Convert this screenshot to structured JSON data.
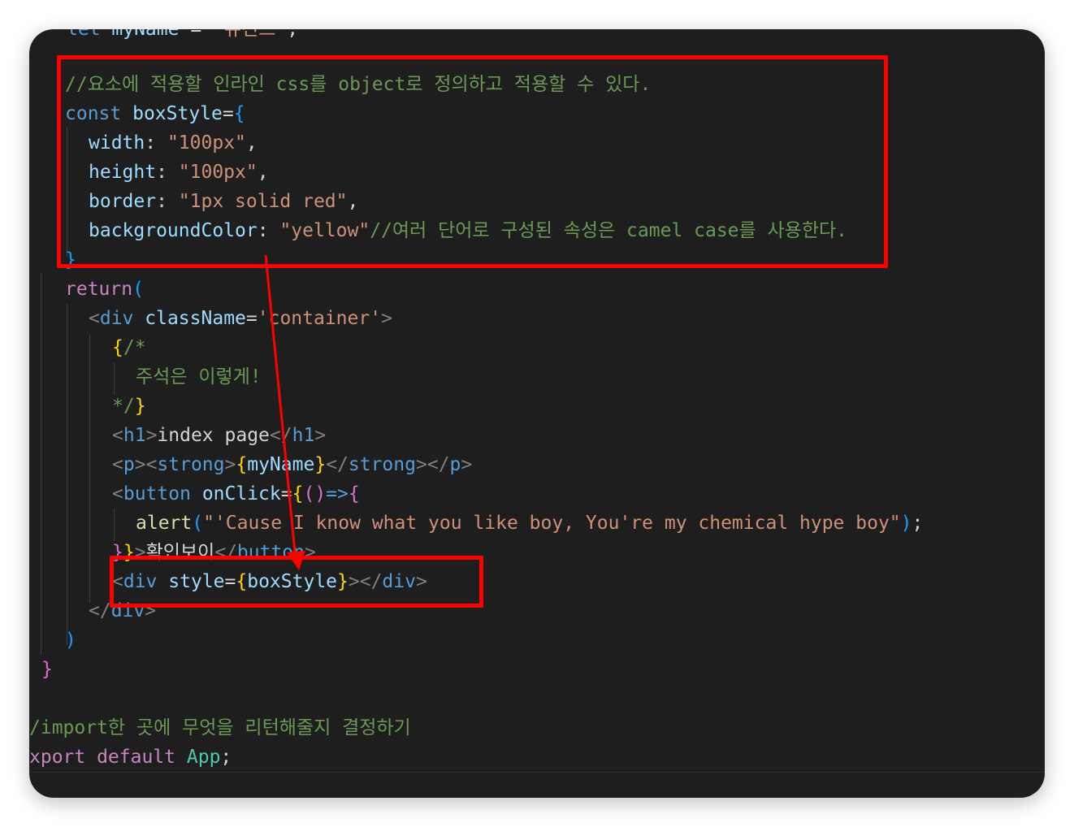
{
  "editor": {
    "lines": [
      {
        "id": "l-top",
        "segs": [
          [
            "kw",
            "let "
          ],
          [
            "var",
            "myName"
          ],
          [
            "pl",
            " = "
          ],
          [
            "str",
            "\"뉴진스\""
          ],
          [
            "pl",
            ";"
          ]
        ]
      },
      {
        "id": "l-comment1",
        "segs": [
          [
            "cm",
            "//요소에 적용할 인라인 css를 object로 정의하고 적용할 수 있다."
          ]
        ]
      },
      {
        "id": "l-const",
        "segs": [
          [
            "kw",
            "const "
          ],
          [
            "var",
            "boxStyle"
          ],
          [
            "pl",
            "="
          ],
          [
            "p3",
            "{"
          ]
        ]
      },
      {
        "id": "l-width",
        "segs": [
          [
            "prop",
            "width"
          ],
          [
            "pl",
            ": "
          ],
          [
            "str",
            "\"100px\""
          ],
          [
            "pl",
            ","
          ]
        ]
      },
      {
        "id": "l-height",
        "segs": [
          [
            "prop",
            "height"
          ],
          [
            "pl",
            ": "
          ],
          [
            "str",
            "\"100px\""
          ],
          [
            "pl",
            ","
          ]
        ]
      },
      {
        "id": "l-border",
        "segs": [
          [
            "prop",
            "border"
          ],
          [
            "pl",
            ": "
          ],
          [
            "str",
            "\"1px solid red\""
          ],
          [
            "pl",
            ","
          ]
        ]
      },
      {
        "id": "l-bg",
        "segs": [
          [
            "prop",
            "backgroundColor"
          ],
          [
            "pl",
            ": "
          ],
          [
            "str",
            "\"yellow\""
          ],
          [
            "cm",
            "//여러 단어로 구성된 속성은 camel case를 사용한다."
          ]
        ]
      },
      {
        "id": "l-close-obj",
        "segs": [
          [
            "p3",
            "}"
          ]
        ]
      },
      {
        "id": "l-return",
        "segs": [
          [
            "ctrl",
            "return"
          ],
          [
            "p3",
            "("
          ]
        ]
      },
      {
        "id": "l-div-open",
        "segs": [
          [
            "ang",
            "<"
          ],
          [
            "tag",
            "div"
          ],
          [
            "pl",
            " "
          ],
          [
            "attr",
            "className"
          ],
          [
            "pl",
            "="
          ],
          [
            "str",
            "'container'"
          ],
          [
            "ang",
            ">"
          ]
        ]
      },
      {
        "id": "l-cm-open",
        "segs": [
          [
            "p1",
            "{"
          ],
          [
            "cm",
            "/*"
          ]
        ]
      },
      {
        "id": "l-cm-body",
        "segs": [
          [
            "cm",
            "주석은 이렇게!"
          ]
        ]
      },
      {
        "id": "l-cm-close",
        "segs": [
          [
            "cm",
            "*/"
          ],
          [
            "p1",
            "}"
          ]
        ]
      },
      {
        "id": "l-h1",
        "segs": [
          [
            "ang",
            "<"
          ],
          [
            "tag",
            "h1"
          ],
          [
            "ang",
            ">"
          ],
          [
            "txt",
            "index page"
          ],
          [
            "ang",
            "</"
          ],
          [
            "tag",
            "h1"
          ],
          [
            "ang",
            ">"
          ]
        ]
      },
      {
        "id": "l-p",
        "segs": [
          [
            "ang",
            "<"
          ],
          [
            "tag",
            "p"
          ],
          [
            "ang",
            "><"
          ],
          [
            "tag",
            "strong"
          ],
          [
            "ang",
            ">"
          ],
          [
            "p1",
            "{"
          ],
          [
            "var",
            "myName"
          ],
          [
            "p1",
            "}"
          ],
          [
            "ang",
            "</"
          ],
          [
            "tag",
            "strong"
          ],
          [
            "ang",
            "></"
          ],
          [
            "tag",
            "p"
          ],
          [
            "ang",
            ">"
          ]
        ]
      },
      {
        "id": "l-button",
        "segs": [
          [
            "ang",
            "<"
          ],
          [
            "tag",
            "button"
          ],
          [
            "pl",
            " "
          ],
          [
            "attr",
            "onClick"
          ],
          [
            "pl",
            "="
          ],
          [
            "p1",
            "{"
          ],
          [
            "p2",
            "()"
          ],
          [
            "kw",
            "=>"
          ],
          [
            "p2",
            "{"
          ]
        ]
      },
      {
        "id": "l-alert",
        "segs": [
          [
            "fn",
            "alert"
          ],
          [
            "p3",
            "("
          ],
          [
            "str",
            "\"'Cause I know what you like boy, You're my chemical hype boy\""
          ],
          [
            "p3",
            ")"
          ],
          [
            "pl",
            ";"
          ]
        ]
      },
      {
        "id": "l-button-close",
        "segs": [
          [
            "p2",
            "}"
          ],
          [
            "p1",
            "}"
          ],
          [
            "ang",
            ">"
          ],
          [
            "txt",
            "확인보이"
          ],
          [
            "ang",
            "</"
          ],
          [
            "tag",
            "button"
          ],
          [
            "ang",
            ">"
          ]
        ]
      },
      {
        "id": "l-div-style",
        "segs": [
          [
            "ang",
            "<"
          ],
          [
            "tag",
            "div"
          ],
          [
            "pl",
            " "
          ],
          [
            "attr",
            "style"
          ],
          [
            "pl",
            "="
          ],
          [
            "p1",
            "{"
          ],
          [
            "var",
            "boxStyle"
          ],
          [
            "p1",
            "}"
          ],
          [
            "ang",
            "></"
          ],
          [
            "tag",
            "div"
          ],
          [
            "ang",
            ">"
          ]
        ]
      },
      {
        "id": "l-div-close",
        "segs": [
          [
            "ang",
            "</"
          ],
          [
            "tag",
            "div"
          ],
          [
            "ang",
            ">"
          ]
        ]
      },
      {
        "id": "l-paren-close",
        "segs": [
          [
            "p3",
            ")"
          ]
        ]
      },
      {
        "id": "l-fn-close",
        "segs": [
          [
            "p2",
            "}"
          ]
        ]
      },
      {
        "id": "l-blank",
        "segs": []
      },
      {
        "id": "l-cm-import",
        "segs": [
          [
            "cm",
            "/import한 곳에 무엇을 리턴해줄지 결정하기"
          ]
        ]
      },
      {
        "id": "l-export",
        "segs": [
          [
            "ctrl",
            "xport default "
          ],
          [
            "cls",
            "App"
          ],
          [
            "pl",
            ";"
          ]
        ]
      }
    ]
  },
  "colors": {
    "annotation": "#ff0000",
    "background": "#1e1e1e"
  }
}
